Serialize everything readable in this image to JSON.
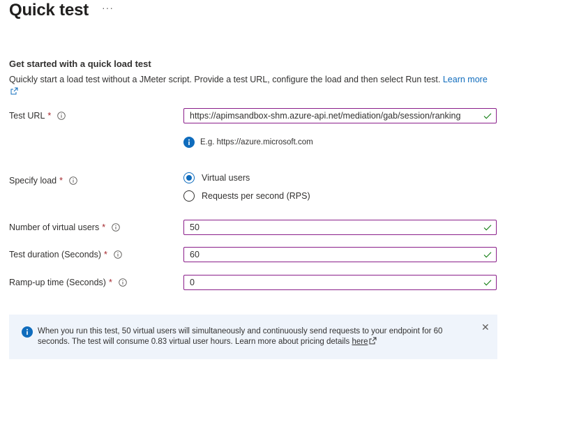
{
  "header": {
    "title": "Quick test",
    "more_label": "···"
  },
  "intro": {
    "heading": "Get started with a quick load test",
    "description": "Quickly start a load test without a JMeter script. Provide a test URL, configure the load and then select Run test.",
    "learn_more": "Learn more"
  },
  "form": {
    "test_url": {
      "label": "Test URL",
      "required": "*",
      "value": "https://apimsandbox-shm.azure-api.net/mediation/gab/session/ranking",
      "hint": "E.g. https://azure.microsoft.com"
    },
    "specify_load": {
      "label": "Specify load",
      "required": "*",
      "options": [
        "Virtual users",
        "Requests per second (RPS)"
      ],
      "selected": "Virtual users"
    },
    "virtual_users": {
      "label": "Number of virtual users",
      "required": "*",
      "value": "50"
    },
    "duration": {
      "label": "Test duration (Seconds)",
      "required": "*",
      "value": "60"
    },
    "ramp_up": {
      "label": "Ramp-up time (Seconds)",
      "required": "*",
      "value": "0"
    }
  },
  "banner": {
    "text": "When you run this test, 50 virtual users will simultaneously and continuously send requests to your endpoint for 60 seconds. The test will consume 0.83 virtual user hours. Learn more about pricing details",
    "link": "here",
    "close_label": "✕"
  },
  "colors": {
    "accent": "#0f6cbd",
    "input_border": "#8a1e8a",
    "valid_check": "#107c10",
    "required": "#a4262c",
    "banner_bg": "#eff4fb"
  },
  "icons": [
    "more-icon",
    "external-link-icon",
    "info-icon",
    "checkmark-icon",
    "info-filled-icon",
    "close-icon"
  ]
}
